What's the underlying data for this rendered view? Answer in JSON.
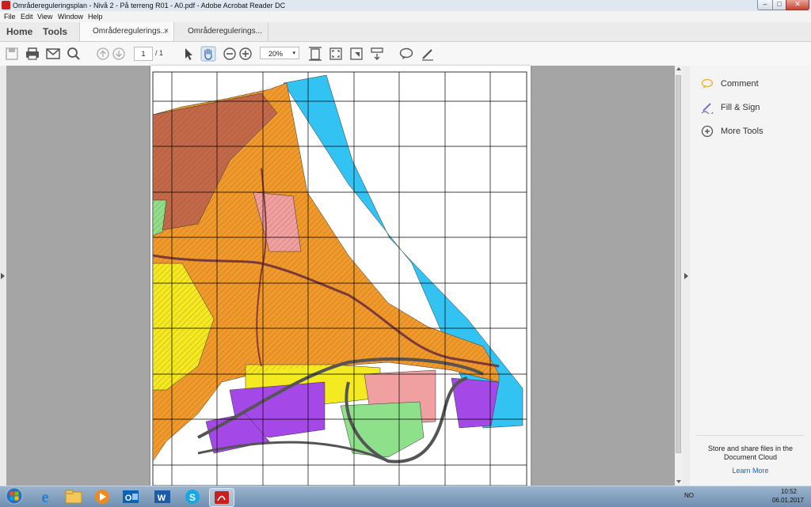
{
  "window": {
    "title": "Områdereguleringsplan - Nivå 2 - På terreng R01 - A0.pdf - Adobe Acrobat Reader DC",
    "minimize_glyph": "–",
    "maximize_glyph": "□",
    "close_glyph": "✕"
  },
  "menu": [
    "File",
    "Edit",
    "View",
    "Window",
    "Help"
  ],
  "tabs": {
    "home": "Home",
    "tools": "Tools",
    "documents": [
      {
        "label": "Områderegulerings...",
        "close": "×"
      },
      {
        "label": "Områderegulerings..."
      }
    ]
  },
  "toolbar": {
    "icons": [
      "save-icon",
      "print-icon",
      "email-icon",
      "search-icon",
      "page-up-icon",
      "page-down-icon",
      "select-arrow-icon",
      "hand-icon",
      "zoom-out-icon",
      "zoom-in-icon",
      "fit-page-icon",
      "full-screen-icon",
      "marquee-zoom-icon",
      "scroll-mode-icon",
      "comment-icon",
      "pen-icon"
    ],
    "page_current": "1",
    "page_total": "/ 1",
    "zoom": "20%",
    "zoom_caret": "▾"
  },
  "right_pane": {
    "tools": [
      {
        "label": "Comment",
        "icon": "comment-icon",
        "color": "#f2b536"
      },
      {
        "label": "Fill & Sign",
        "icon": "fill-sign-icon",
        "color": "#7b6fc2"
      },
      {
        "label": "More Tools",
        "icon": "plus-circle-icon",
        "color": "#555555"
      }
    ],
    "cloud_text": "Store and share files in the Document Cloud",
    "learn_more": "Learn More"
  },
  "taskbar": {
    "apps": [
      "windows-start-icon",
      "internet-explorer-icon",
      "file-explorer-icon",
      "media-player-icon",
      "outlook-icon",
      "word-icon",
      "skype-icon",
      "acrobat-icon"
    ],
    "language": "NO",
    "time": "10:52",
    "date": "06.01.2017"
  },
  "colors": {
    "map_cyan": "#33c3f2",
    "map_orange": "#ef9a2a",
    "map_yellow": "#f4ea22",
    "map_purple": "#a548e8",
    "map_green": "#8ee08a",
    "map_pink": "#f0a0a0",
    "map_brown": "#c2694a"
  }
}
